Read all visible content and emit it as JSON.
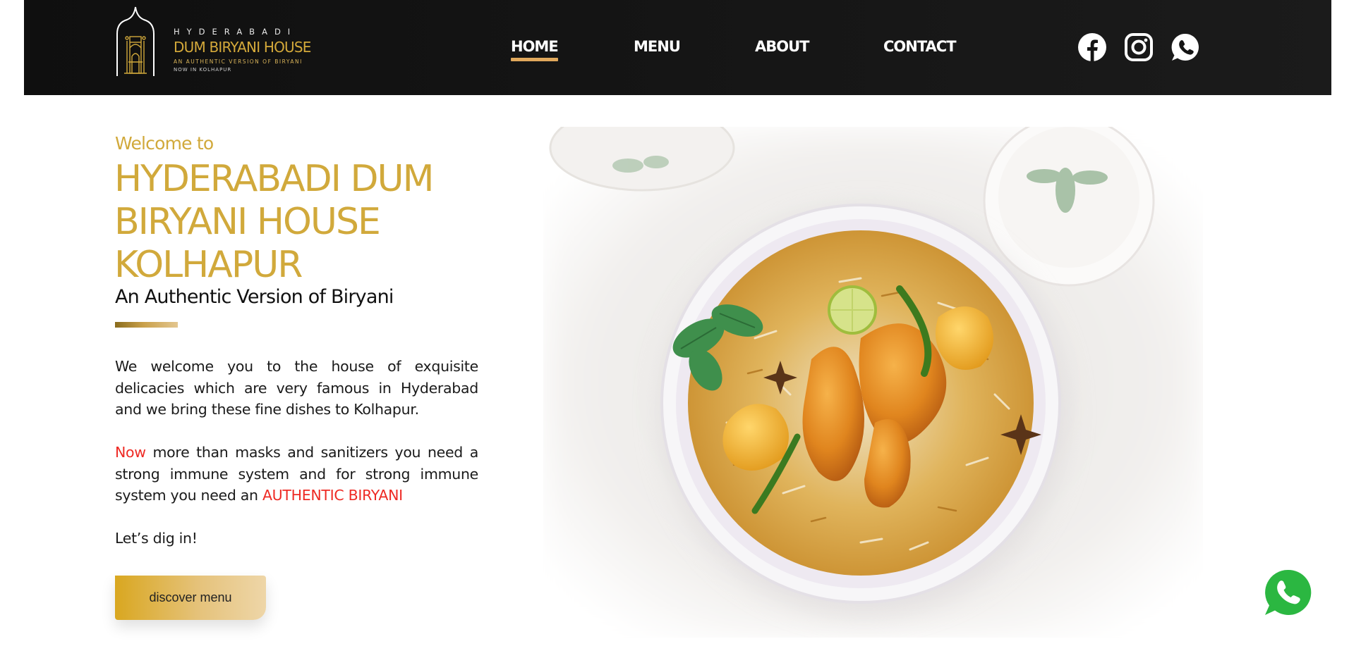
{
  "brand": {
    "line1": "HYDERABADI",
    "line2": "DUM BIRYANI HOUSE",
    "line3": "AN AUTHENTIC VERSION OF BIRYANI",
    "line4": "NOW IN KOLHAPUR",
    "gold": "#d1a93b"
  },
  "nav": {
    "items": [
      {
        "label": "HOME",
        "active": true
      },
      {
        "label": "MENU",
        "active": false
      },
      {
        "label": "ABOUT",
        "active": false
      },
      {
        "label": "CONTACT",
        "active": false
      }
    ],
    "active_underline": "#e0a85c"
  },
  "social": {
    "icons": [
      "facebook-icon",
      "instagram-icon",
      "whatsapp-icon"
    ]
  },
  "hero": {
    "welcome": "Welcome to",
    "title_line1": "HYDERABADI DUM",
    "title_line2": "BIRYANI HOUSE",
    "title_line3": "KOLHAPUR",
    "subtitle": "An Authentic Version of Biryani",
    "para1": "We welcome you to the house of exquisite delicacies which are very famous in Hyderabad and we bring these fine dishes to Kolhapur.",
    "para2_red_start": "Now",
    "para2_middle": " more than masks and sanitizers you need a strong immune system and for strong immune system you need an ",
    "para2_red_end": "AUTHENTIC BIRYANI",
    "para3": "Let’s dig in!",
    "cta": "discover menu",
    "accent_red": "#ee2a24"
  },
  "floating": {
    "icon": "whatsapp-float-icon",
    "color": "#2bb741"
  }
}
